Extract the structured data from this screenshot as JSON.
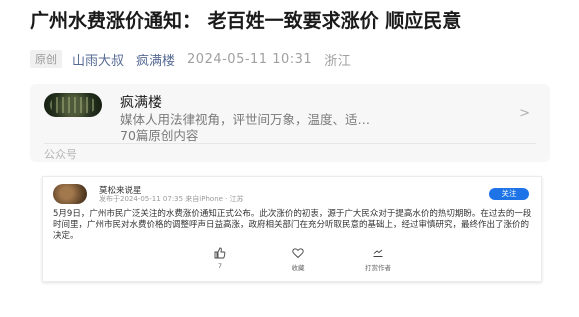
{
  "article": {
    "title": "广州水费涨价通知： 老百姓一致要求涨价 顺应民意",
    "original_badge": "原创",
    "author": "山雨大叔",
    "account": "疯满楼",
    "datetime": "2024-05-11 10:31",
    "location": "浙江"
  },
  "account_card": {
    "name": "疯满楼",
    "description": "媒体人用法律视角，评世间万象，温度、适…",
    "count": "70篇原创内容",
    "type": "公众号"
  },
  "embed": {
    "name": "莫松来说星",
    "sub": "发布于2024-05-11 07:35 来自iPhone · 江苏",
    "follow": "关注",
    "body": "5月9日，广州市民广泛关注的水费涨价通知正式公布。此次涨价的初衷，源于广大民众对于提高水价的热切期盼。在过去的一段时间里，广州市民对水费价格的调整呼声日益高涨，政府相关部门在充分听取民意的基础上，经过审慎研究，最终作出了涨价的决定。",
    "actions": {
      "like_icon": "thumbs-up-icon",
      "like_count": "7",
      "fav_icon": "heart-icon",
      "fav_label": "收藏",
      "tip_icon": "tip-icon",
      "tip_label": "打赏作者"
    }
  }
}
